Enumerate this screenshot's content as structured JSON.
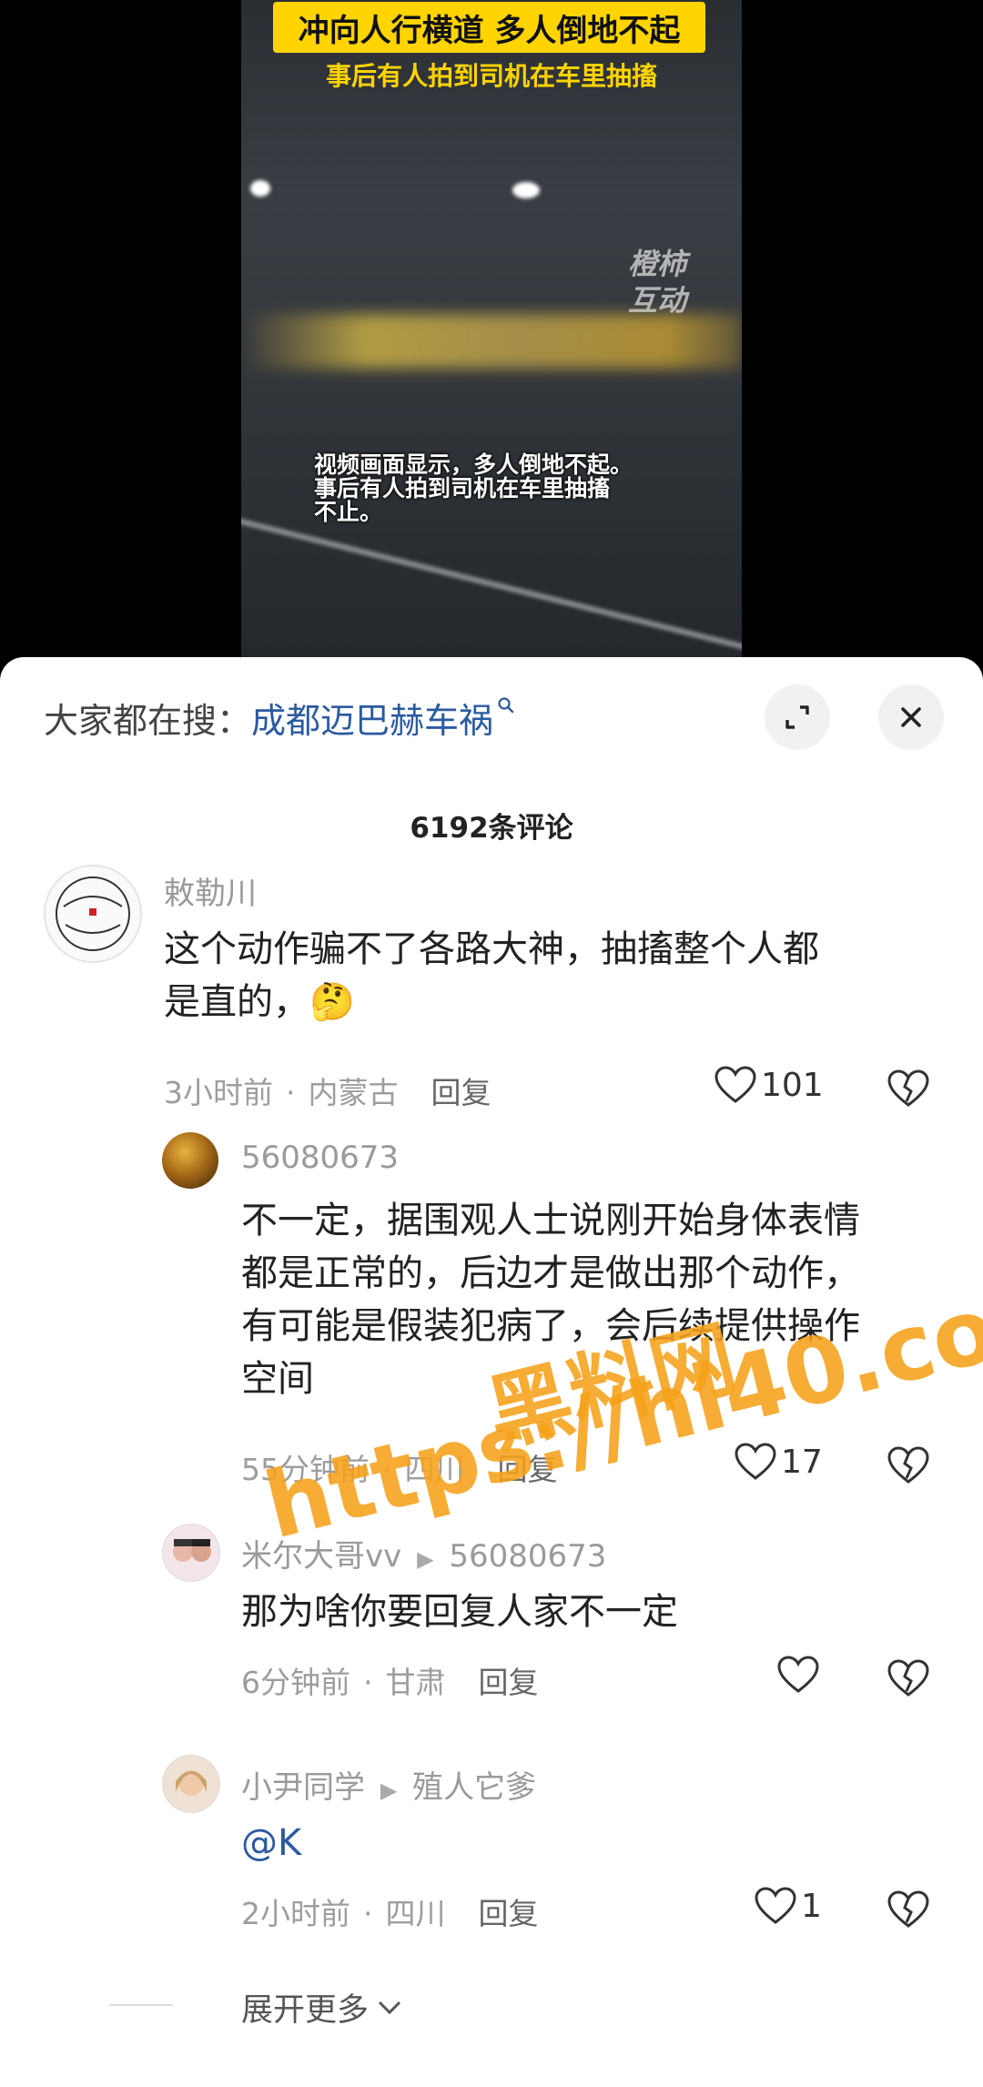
{
  "video": {
    "headline": "冲向人行横道 多人倒地不起",
    "subheadline": "事后有人拍到司机在车里抽搐",
    "source_watermark": "橙柿\n互动",
    "caption": "视频画面显示，多人倒地不起。\n事后有人拍到司机在车里抽搐\n不止。"
  },
  "search": {
    "label": "大家都在搜：",
    "term": "成都迈巴赫车祸"
  },
  "comments_header": {
    "count_label": "6192条评论"
  },
  "comments": [
    {
      "username": "敕勒川",
      "text": "这个动作骗不了各路大神，抽搐整个人都\n是直的，",
      "emoji": "🤔",
      "time": "3小时前",
      "location": "内蒙古",
      "reply_label": "回复",
      "likes": "101"
    },
    {
      "username": "56080673",
      "text": "不一定，据围观人士说刚开始身体表情\n都是正常的，后边才是做出那个动作，\n有可能是假装犯病了，会后续提供操作\n空间",
      "time": "55分钟前",
      "location": "四川",
      "reply_label": "回复",
      "likes": "17"
    },
    {
      "username": "米尔大哥vv",
      "reply_to": "56080673",
      "text": "那为啥你要回复人家不一定",
      "time": "6分钟前",
      "location": "甘肃",
      "reply_label": "回复",
      "likes": ""
    },
    {
      "username": "小尹同学",
      "reply_to": "殖人它爹",
      "text": "@K",
      "time": "2小时前",
      "location": "四川",
      "reply_label": "回复",
      "likes": "1"
    }
  ],
  "expand": {
    "label": "展开更多"
  },
  "overlay_watermark": {
    "line1": "黑料网",
    "line2": "https://hl40.co"
  },
  "colors": {
    "headline_bg": "#ffd400",
    "link_blue": "#2b5aa0",
    "watermark_orange": "#f5a019"
  }
}
